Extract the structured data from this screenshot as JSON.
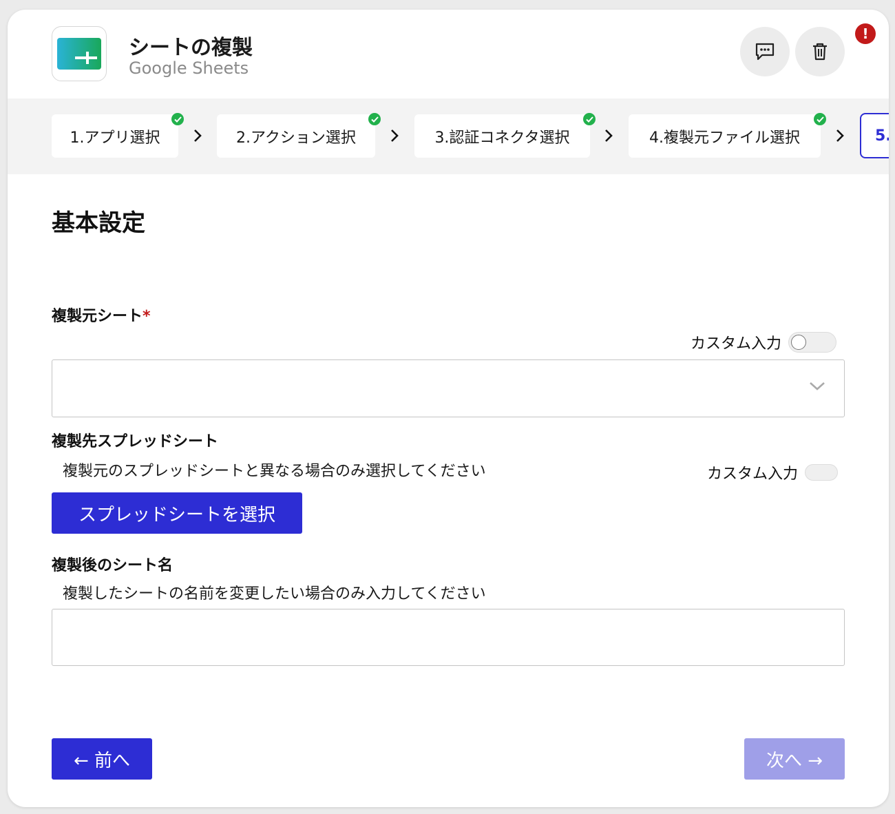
{
  "header": {
    "title": "シートの複製",
    "app_name": "Google Sheets",
    "alert_symbol": "!"
  },
  "steps": [
    {
      "label": "1.アプリ選択",
      "done": true
    },
    {
      "label": "2.アクション選択",
      "done": true
    },
    {
      "label": "3.認証コネクタ選択",
      "done": true
    },
    {
      "label": "4.複製元ファイル選択",
      "done": true
    },
    {
      "label": "5.",
      "done": false,
      "active": true
    }
  ],
  "form": {
    "section_title": "基本設定",
    "source_sheet": {
      "label": "複製元シート",
      "required_mark": "*",
      "custom_input_label": "カスタム入力",
      "value": ""
    },
    "dest_spreadsheet": {
      "label": "複製先スプレッドシート",
      "hint": "複製元のスプレッドシートと異なる場合のみ選択してください",
      "custom_input_label": "カスタム入力",
      "button_label": "スプレッドシートを選択"
    },
    "new_sheet_name": {
      "label": "複製後のシート名",
      "hint": "複製したシートの名前を変更したい場合のみ入力してください",
      "value": ""
    }
  },
  "footer": {
    "prev_label": "← 前へ",
    "next_label": "次へ →"
  },
  "colors": {
    "primary": "#2d2dd4",
    "primary_disabled": "#9f9fe8",
    "success": "#22b14c",
    "alert": "#c21a1a"
  }
}
